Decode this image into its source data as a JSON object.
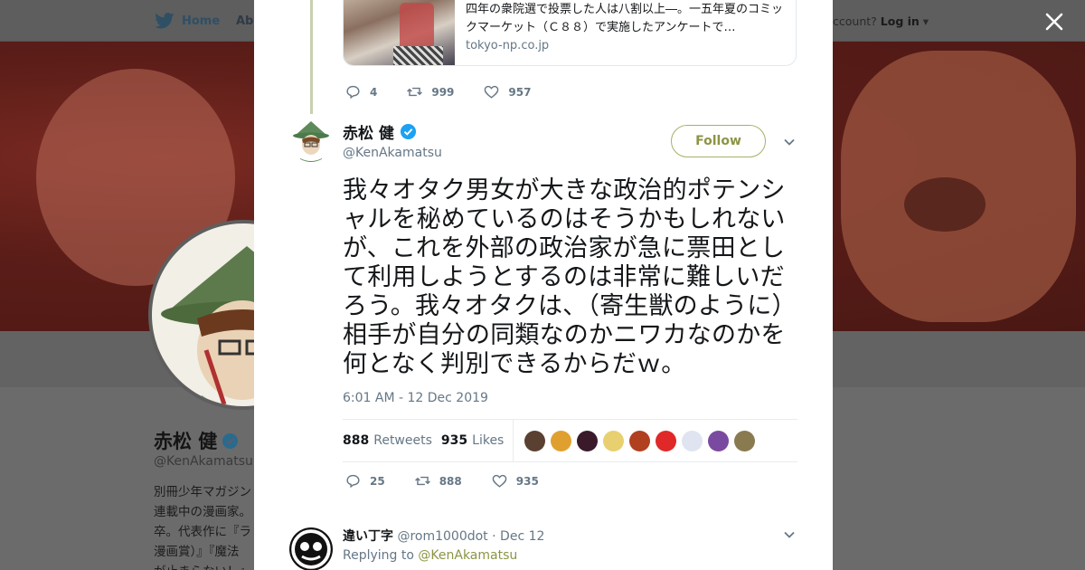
{
  "background": {
    "nav": {
      "home_label": "Home",
      "about_label": "Abo"
    },
    "account": {
      "prompt": "ccount?",
      "login_label": "Log in"
    },
    "profile": {
      "name": "赤松 健",
      "handle": "@KenAkamatsu",
      "bio_lines": [
        "別冊少年マガジン",
        "連載中の漫画家。",
        "卒。代表作に『ラ",
        "漫画賞）』『魔法",
        "が止まらない！』"
      ]
    }
  },
  "quoted_card": {
    "text": "四年の衆院選で投票した人は八割以上―。一五年夏のコミックマーケット（Ｃ８８）で実施したアンケートで…",
    "domain": "tokyo-np.co.jp"
  },
  "prev_actions": {
    "replies": "4",
    "retweets": "999",
    "likes": "957"
  },
  "tweet": {
    "name": "赤松 健",
    "handle": "@KenAkamatsu",
    "follow_label": "Follow",
    "text": "我々オタク男女が大きな政治的ポテンシャルを秘めているのはそうかもしれないが、これを外部の政治家が急に票田として利用しようとするのは非常に難しいだろう。我々オタクは、（寄生獣のように）相手が自分の同類なのかニワカなのかを何となく判別できるからだｗ。",
    "timestamp": "6:01 AM - 12 Dec 2019",
    "stats": {
      "retweets_count": "888",
      "retweets_label": "Retweets",
      "likes_count": "935",
      "likes_label": "Likes"
    },
    "liker_colors": [
      "#5a4030",
      "#e0a030",
      "#3a1a2a",
      "#e8d070",
      "#b04020",
      "#e02828",
      "#dfe4f0",
      "#7a4aa0",
      "#8a7a50"
    ],
    "actions": {
      "replies": "25",
      "retweets": "888",
      "likes": "935"
    }
  },
  "reply": {
    "name": "違い丁字",
    "handle": "@rom1000dot",
    "date": "Dec 12",
    "replying_prefix": "Replying to",
    "replying_to": "@KenAkamatsu"
  },
  "colors": {
    "accent": "#8d9443",
    "verified": "#1da1f2",
    "text": "#14171a",
    "muted": "#657786"
  }
}
